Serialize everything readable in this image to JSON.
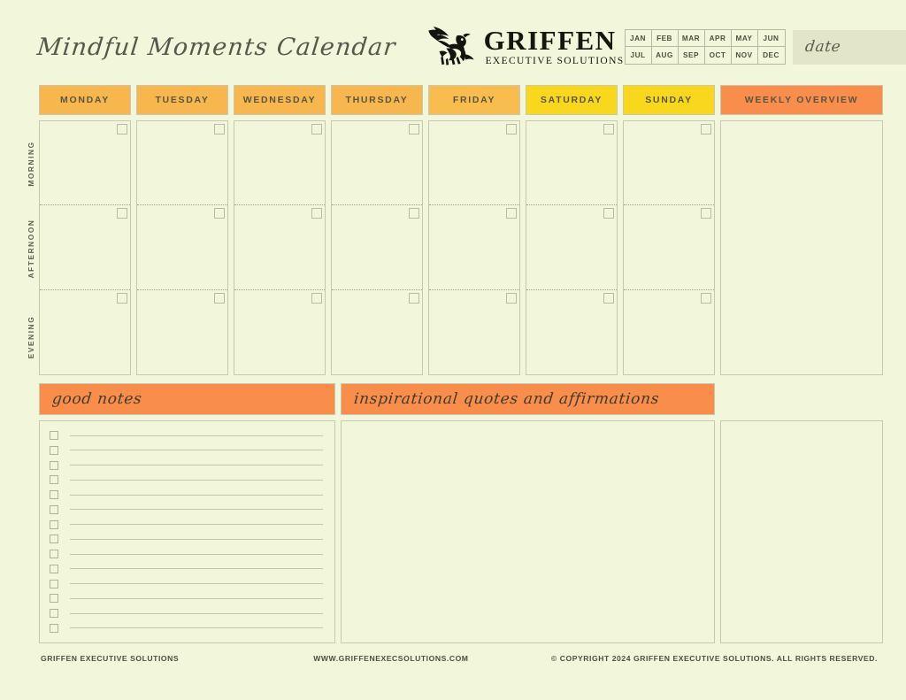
{
  "header": {
    "title": "Mindful Moments Calendar",
    "brand_name": "GRIFFEN",
    "brand_subtitle": "EXECUTIVE SOLUTIONS",
    "date_label": "date",
    "months": [
      "JAN",
      "FEB",
      "MAR",
      "APR",
      "MAY",
      "JUN",
      "JUL",
      "AUG",
      "SEP",
      "OCT",
      "NOV",
      "DEC"
    ]
  },
  "calendar": {
    "days": [
      {
        "label": "MONDAY",
        "color": "#f7b74e"
      },
      {
        "label": "TUESDAY",
        "color": "#f7b74e"
      },
      {
        "label": "WEDNESDAY",
        "color": "#f7b74e"
      },
      {
        "label": "THURSDAY",
        "color": "#f7b74e"
      },
      {
        "label": "FRIDAY",
        "color": "#f9bc4f"
      },
      {
        "label": "SATURDAY",
        "color": "#fad71f"
      },
      {
        "label": "SUNDAY",
        "color": "#fad71f"
      }
    ],
    "overview_label": "WEEKLY OVERVIEW",
    "overview_color": "#f98e4c",
    "time_blocks": [
      "MORNING",
      "AFTERNOON",
      "EVENING"
    ]
  },
  "sections": {
    "notes_title": "good notes",
    "notes_color": "#f98e4c",
    "quotes_title": "inspirational quotes and affirmations",
    "quotes_color": "#f98e4c",
    "note_row_count": 14
  },
  "footer": {
    "company": "GRIFFEN EXECUTIVE SOLUTIONS",
    "website": "WWW.GRIFFENEXECSOLUTIONS.COM",
    "copyright": "© COPYRIGHT 2024 GRIFFEN EXECUTIVE SOLUTIONS. ALL RIGHTS RESERVED."
  },
  "theme": {
    "background": "#f2f6db",
    "border": "#c6c8b0",
    "date_field_bg": "#e3e5cb",
    "text": "#4b4f40"
  }
}
